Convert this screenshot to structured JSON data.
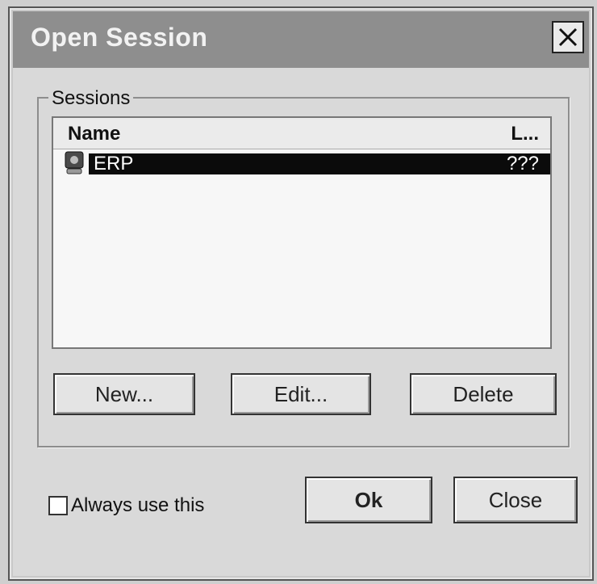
{
  "window": {
    "title": "Open Session",
    "close_glyph": "✕"
  },
  "sessions": {
    "group_label": "Sessions",
    "columns": {
      "name": "Name",
      "last": "L..."
    },
    "rows": [
      {
        "name": "ERP",
        "last": "???",
        "selected": true,
        "icon": "session-icon"
      }
    ],
    "buttons": {
      "new": "New...",
      "edit": "Edit...",
      "delete": "Delete"
    }
  },
  "footer": {
    "checkbox_label": "Always use this",
    "checkbox_checked": false,
    "ok_label": "Ok",
    "close_label": "Close"
  }
}
